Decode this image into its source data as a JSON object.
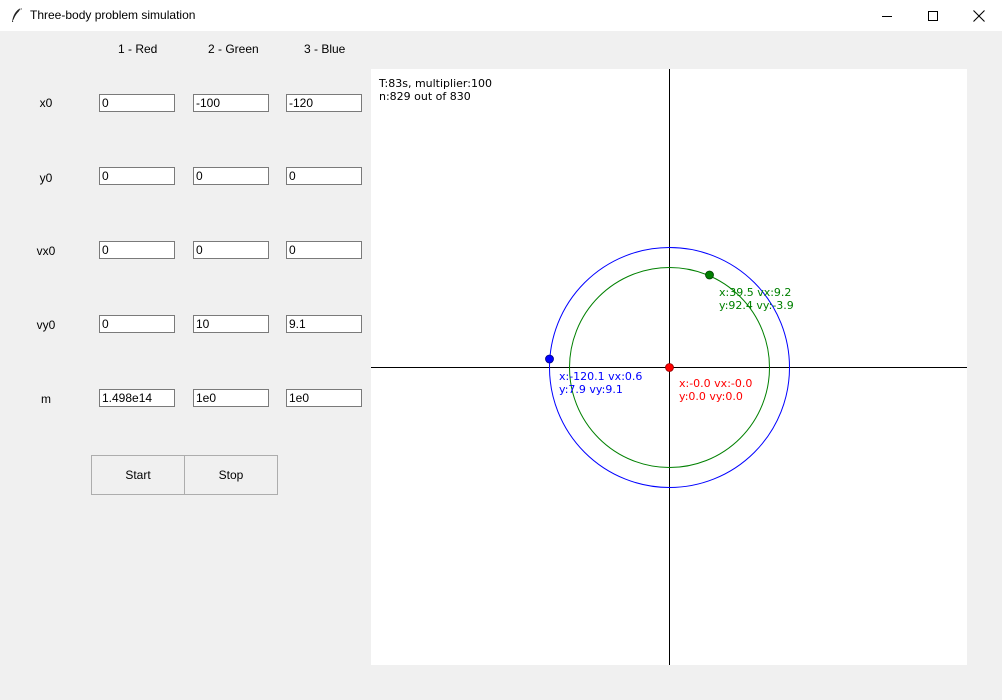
{
  "window": {
    "title": "Three-body problem simulation",
    "app_icon": "feather-icon",
    "controls": [
      "minimize-icon",
      "maximize-icon",
      "close-icon"
    ]
  },
  "columns": [
    "1 - Red",
    "2 - Green",
    "3 - Blue"
  ],
  "rows": [
    {
      "label": "x0",
      "values": [
        "0",
        "-100",
        "-120"
      ]
    },
    {
      "label": "y0",
      "values": [
        "0",
        "0",
        "0"
      ]
    },
    {
      "label": "vx0",
      "values": [
        "0",
        "0",
        "0"
      ]
    },
    {
      "label": "vy0",
      "values": [
        "0",
        "10",
        "9.1"
      ]
    },
    {
      "label": "m",
      "values": [
        "1.498e14",
        "1e0",
        "1e0"
      ]
    }
  ],
  "buttons": {
    "start": "Start",
    "stop": "Stop"
  },
  "canvas": {
    "status_line1": "T:83s, multiplier:100",
    "status_line2": "n:829 out of 830",
    "bodies": [
      {
        "name": "red",
        "color": "#ff0000",
        "line1": "x:-0.0 vx:-0.0",
        "line2": "y:0.0 vy:0.0"
      },
      {
        "name": "green",
        "color": "#008000",
        "line1": "x:39.5 vx:9.2",
        "line2": "y:92.4 vy:-3.9"
      },
      {
        "name": "blue",
        "color": "#0000ff",
        "line1": "x:-120.1 vx:0.6",
        "line2": "y:7.9 vy:9.1"
      }
    ]
  }
}
